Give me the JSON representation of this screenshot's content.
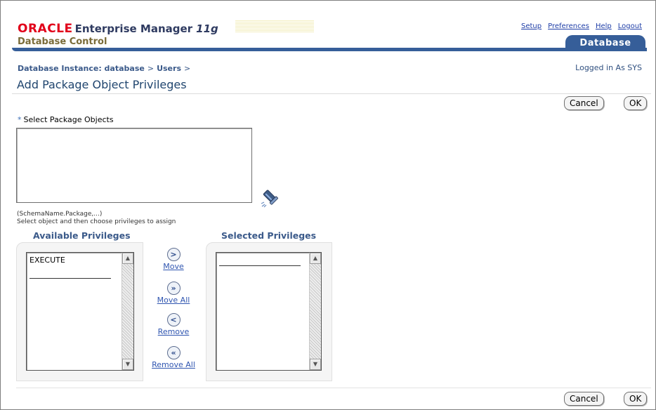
{
  "header": {
    "brand": "ORACLE",
    "product": "Enterprise Manager",
    "version": "11g",
    "subtitle": "Database Control",
    "links": [
      "Setup",
      "Preferences",
      "Help",
      "Logout"
    ],
    "tab": "Database"
  },
  "breadcrumb": {
    "items": [
      "Database Instance: database",
      "Users"
    ],
    "separator": ">"
  },
  "logged_in": "Logged in As SYS",
  "page_title": "Add Package Object Privileges",
  "buttons": {
    "cancel": "Cancel",
    "ok": "OK"
  },
  "package_objects": {
    "label": "Select Package Objects",
    "value": "",
    "hint_format": "(SchemaName.Package,...)",
    "hint_instruction": "Select object and then choose privileges to assign"
  },
  "shuttle": {
    "available_title": "Available Privileges",
    "selected_title": "Selected Privileges",
    "available_items": [
      "EXECUTE"
    ],
    "selected_items": [],
    "move": {
      "label": "Move",
      "icon": ">"
    },
    "move_all": {
      "label": "Move All",
      "icon": "»"
    },
    "remove": {
      "label": "Remove",
      "icon": "<"
    },
    "remove_all": {
      "label": "Remove All",
      "icon": "«"
    }
  },
  "colors": {
    "oracle_red": "#e1001a",
    "header_blue": "#365e99",
    "link_blue": "#1f3ea7",
    "heading_blue": "#21466f"
  }
}
